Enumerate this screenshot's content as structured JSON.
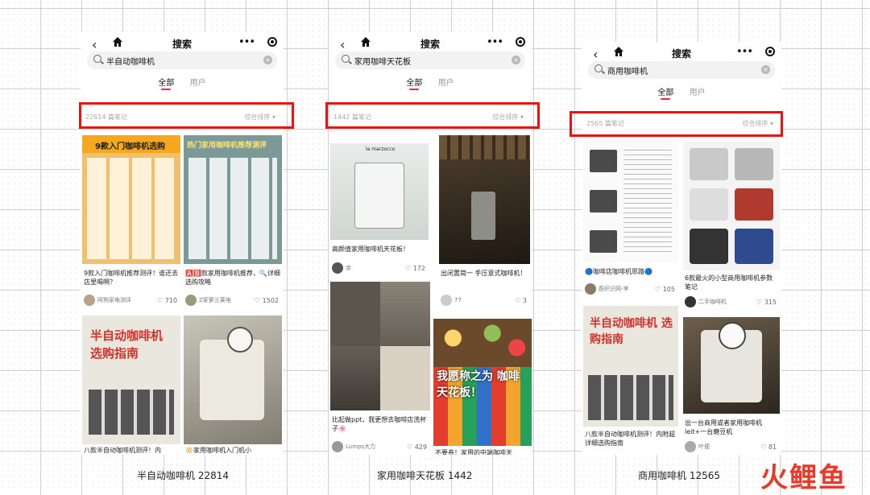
{
  "colors": {
    "accent": "#ff2442",
    "highlight_box": "#ee1111",
    "logo": "#e8392a"
  },
  "screens": [
    {
      "title": "搜索",
      "search_value": "半自动咖啡机",
      "tabs": [
        "全部",
        "用户"
      ],
      "count": "22614 篇笔记",
      "sort": "综合排序",
      "cards": [
        {
          "title": "9款入门咖啡机推荐测评！谁还去店里喝啊？",
          "author": "阿狗家电测评",
          "likes": "710",
          "banner": "9款入门咖啡机选购"
        },
        {
          "title": "🅰️🅱️款家用咖啡机推荐，🔍详细选购攻略",
          "author": "Z家萝兰莱电",
          "likes": "1502",
          "banner": "热门家用咖啡机推荐测评"
        },
        {
          "title": "八款半自动咖啡机测评！内",
          "author": "",
          "likes": "",
          "banner": "半自动咖啡机 选购指南"
        },
        {
          "title": "🔆家用咖啡机入门机小",
          "author": "",
          "likes": "",
          "banner": ""
        }
      ],
      "caption": "半自动咖啡机 22814"
    },
    {
      "title": "搜索",
      "search_value": "家用咖啡天花板",
      "tabs": [
        "全部",
        "用户"
      ],
      "count": "1442 篇笔记",
      "sort": "综合排序",
      "cards": [
        {
          "title": "高颜值家用咖啡机天花板！",
          "author": "余",
          "likes": "172",
          "banner": "la marzocco"
        },
        {
          "title": "出闭置简一 手压意式咖啡机！",
          "author": "77",
          "likes": "3",
          "banner": ""
        },
        {
          "title": "比起做ppt，我更想去咖啡店洗杯子🌸",
          "author": "Lumps大力",
          "likes": "429",
          "banner": ""
        },
        {
          "title": "不要卷！家用的中端咖啡天",
          "author": "",
          "likes": "",
          "banner": "我愿称之为 咖啡天花板！"
        }
      ],
      "caption": "家用咖啡天花板 1442"
    },
    {
      "title": "搜索",
      "search_value": "商用咖啡机",
      "tabs": [
        "全部",
        "用户"
      ],
      "count": "2565 篇笔记",
      "sort": "综合排序",
      "cards": [
        {
          "title": "🔵咖啡店咖啡机思路🔵",
          "author": "蔚织识网-李",
          "likes": "105",
          "banner": ""
        },
        {
          "title": "6款最火的小型商用咖啡机参数笔记",
          "author": "二手咖啡机",
          "likes": "315",
          "banner": ""
        },
        {
          "title": "八款半自动咖啡机测评！内附超详细选购指南",
          "author": "",
          "likes": "",
          "banner": "半自动咖啡机 选购指南"
        },
        {
          "title": "出一台商用或者家用咖啡机leit+一台磨豆机",
          "author": "叶便",
          "likes": "81",
          "banner": ""
        }
      ],
      "caption": "商用咖啡机 12565"
    }
  ],
  "logo_text": "火鲤鱼"
}
